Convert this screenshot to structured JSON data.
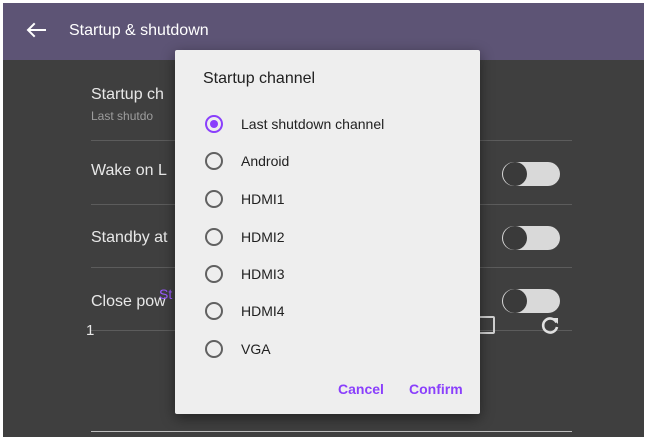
{
  "appbar": {
    "title": "Startup & shutdown",
    "back_icon": "arrow-left-icon"
  },
  "settings": {
    "rows": [
      {
        "title": "Startup ch",
        "subtitle": "Last shutdo"
      },
      {
        "title": "Wake on L",
        "toggle_on": false
      },
      {
        "title": "Standby at",
        "toggle_on": false
      },
      {
        "title": "Close pow",
        "toggle_on": false
      }
    ],
    "section_label": "St",
    "schedule_row": {
      "number": "1",
      "refresh_icon": "refresh-icon"
    }
  },
  "dialog": {
    "title": "Startup channel",
    "selected": "Last shutdown channel",
    "options": [
      "Last shutdown channel",
      "Android",
      "HDMI1",
      "HDMI2",
      "HDMI3",
      "HDMI4",
      "VGA"
    ],
    "cancel_label": "Cancel",
    "confirm_label": "Confirm"
  },
  "colors": {
    "appbar": "#5d5475",
    "background": "#3f3f3f",
    "dialog": "#eeeeee",
    "accent": "#8a3ffc"
  }
}
